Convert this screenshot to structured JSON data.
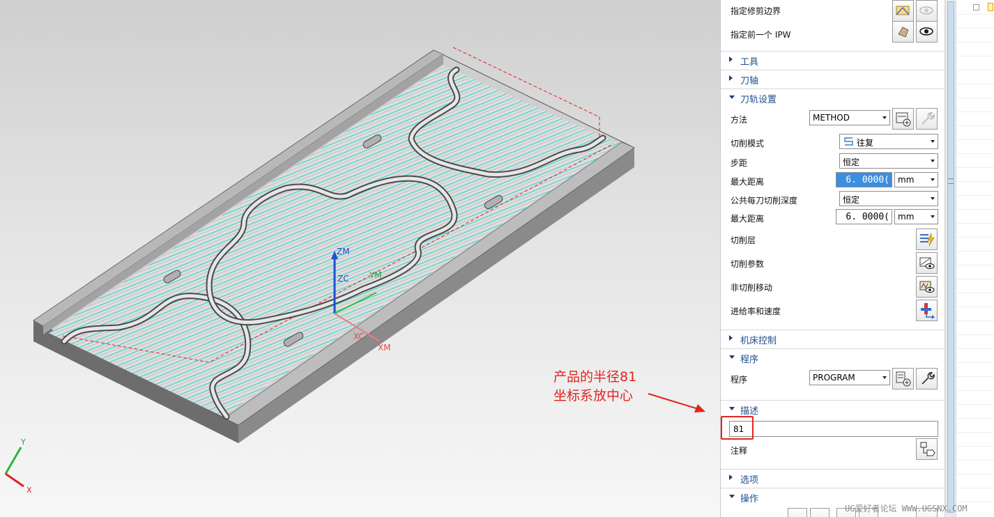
{
  "graphics": {
    "axis_labels": {
      "zm": "ZM",
      "zc": "ZC",
      "ym": "YM",
      "xc": "XC",
      "xm": "XM"
    },
    "triad_labels": {
      "y": "Y",
      "x": "X"
    },
    "annotation": {
      "line1": "产品的半径81",
      "line2": "坐标系放中心",
      "color": "#e0261f"
    }
  },
  "geometry_section": {
    "trim_boundary": {
      "label": "指定修剪边界"
    },
    "previous_ipw": {
      "label": "指定前一个 IPW"
    }
  },
  "sections": {
    "tool": "工具",
    "tool_axis": "刀轴",
    "path_settings": "刀轨设置",
    "machine_control": "机床控制",
    "program": "程序",
    "description": "描述",
    "options": "选项",
    "actions": "操作"
  },
  "path_settings": {
    "method_label": "方法",
    "method_value": "METHOD",
    "cut_pattern_label": "切削模式",
    "cut_pattern_value": "往复",
    "stepover_label": "步距",
    "stepover_value": "恒定",
    "max_distance_label": "最大距离",
    "max_distance_value": "6. 0000(",
    "max_distance_unit": "mm",
    "common_depth_label": "公共每刀切削深度",
    "common_depth_value": "恒定",
    "max_distance2_label": "最大距离",
    "max_distance2_value": "6. 0000(",
    "max_distance2_unit": "mm",
    "cut_levels_label": "切削层",
    "cutting_params_label": "切削参数",
    "non_cutting_label": "非切削移动",
    "feeds_speeds_label": "进给率和速度"
  },
  "program": {
    "label": "程序",
    "value": "PROGRAM"
  },
  "description": {
    "value": "81",
    "notes_label": "注释"
  },
  "watermark": "UG爱好者论坛 WWW.UGSNX.COM",
  "colors": {
    "accent": "#1f4e8c",
    "highlight_border": "#e0261f",
    "toolpath": "#2fd6c9",
    "selection": "#3b8fe0"
  }
}
